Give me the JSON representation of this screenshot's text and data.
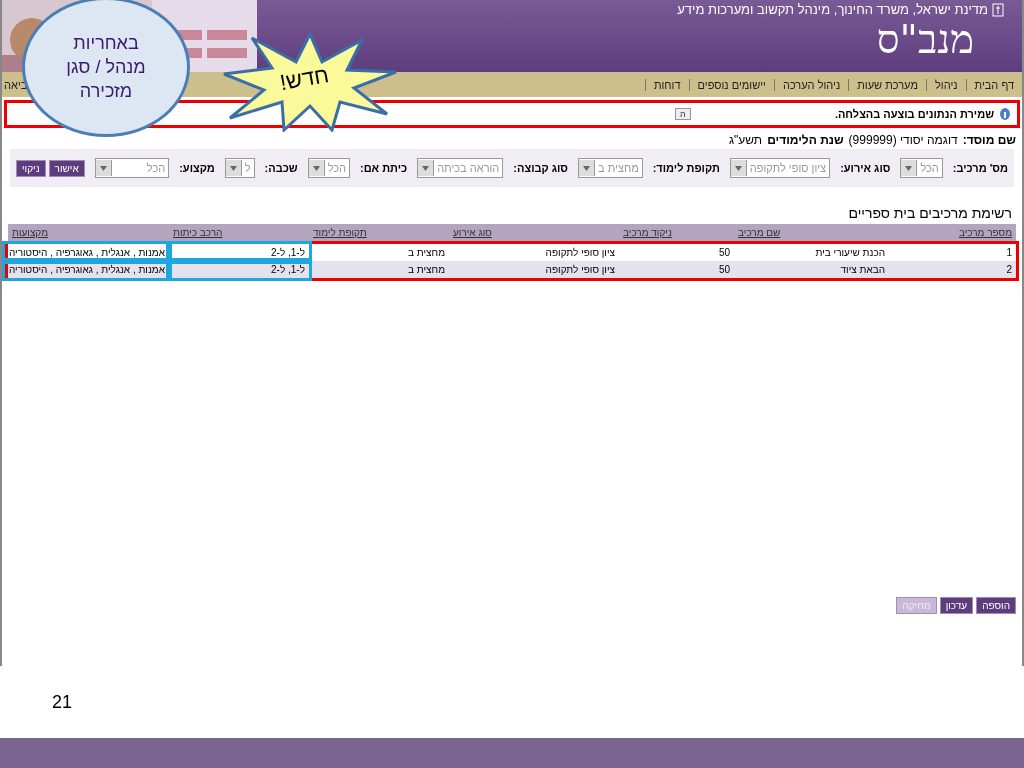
{
  "header": {
    "ministry": "מדינת ישראל, משרד החינוך, מינהל תקשוב ומערכות מידע",
    "logo": "מנב\"ס"
  },
  "nav": {
    "items": [
      "דף הבית",
      "ניהול",
      "מערכת שעות",
      "ניהול הערכה",
      "יישומים נוספים",
      "דוחות"
    ],
    "exit": "ביאה"
  },
  "message": {
    "text": "שמירת הנתונים בוצעה בהצלחה.",
    "highlighted": true
  },
  "collapse_button": "ה",
  "institution": {
    "label": "שם מוסד:",
    "value": "דוגמה יסודי (999999)",
    "year_label": "שנת הלימודים",
    "year": "תשע\"ג"
  },
  "filters": [
    {
      "label": "מס' מרכיב:",
      "value": "הכל",
      "wide": false
    },
    {
      "label": "סוג אירוע:",
      "value": "ציון סופי לתקופה",
      "wide": false
    },
    {
      "label": "תקופת לימוד:",
      "value": "מחצית ב",
      "wide": false
    },
    {
      "label": "סוג קבוצה:",
      "value": "הוראה בכיתה",
      "wide": false
    },
    {
      "label": "כיתת אם:",
      "value": "הכל",
      "wide": false
    },
    {
      "label": "שכבה:",
      "value": "ל",
      "wide": false
    },
    {
      "label": "מקצוע:",
      "value": "הכל",
      "wide": true
    }
  ],
  "filter_buttons": [
    "אישור",
    "ניקוי"
  ],
  "table": {
    "title": "רשימת מרכיבים בית ספריים",
    "highlighted": true,
    "columns": [
      {
        "label": "מספר מרכיב",
        "highlighted": false
      },
      {
        "label": "שם מרכיב",
        "highlighted": false
      },
      {
        "label": "ניקוד מרכיב",
        "highlighted": false
      },
      {
        "label": "סוג אירוע",
        "highlighted": false
      },
      {
        "label": "תקופת לימוד",
        "highlighted": false
      },
      {
        "label": "הרכב כיתות",
        "highlighted": true
      },
      {
        "label": "מקצועות",
        "highlighted": true
      }
    ],
    "rows": [
      [
        "1",
        "הכנת שיעורי בית",
        "50",
        "ציון סופי לתקופה",
        "מחצית ב",
        "ל-1, ל-2",
        "אמנות , אנגלית , גאוגרפיה , היסטוריה"
      ],
      [
        "2",
        "הבאת ציוד",
        "50",
        "ציון סופי לתקופה",
        "מחצית ב",
        "ל-1, ל-2",
        "אמנות , אנגלית , גאוגרפיה , היסטוריה"
      ]
    ]
  },
  "actions": [
    {
      "label": "הוספה",
      "disabled": false
    },
    {
      "label": "עדכון",
      "disabled": false
    },
    {
      "label": "מחיקה",
      "disabled": true
    }
  ],
  "callouts": {
    "bubble": [
      "באחריות",
      "מנהל / סגן",
      "מזכירה"
    ],
    "burst": "חדש!"
  },
  "slide_number": "21"
}
